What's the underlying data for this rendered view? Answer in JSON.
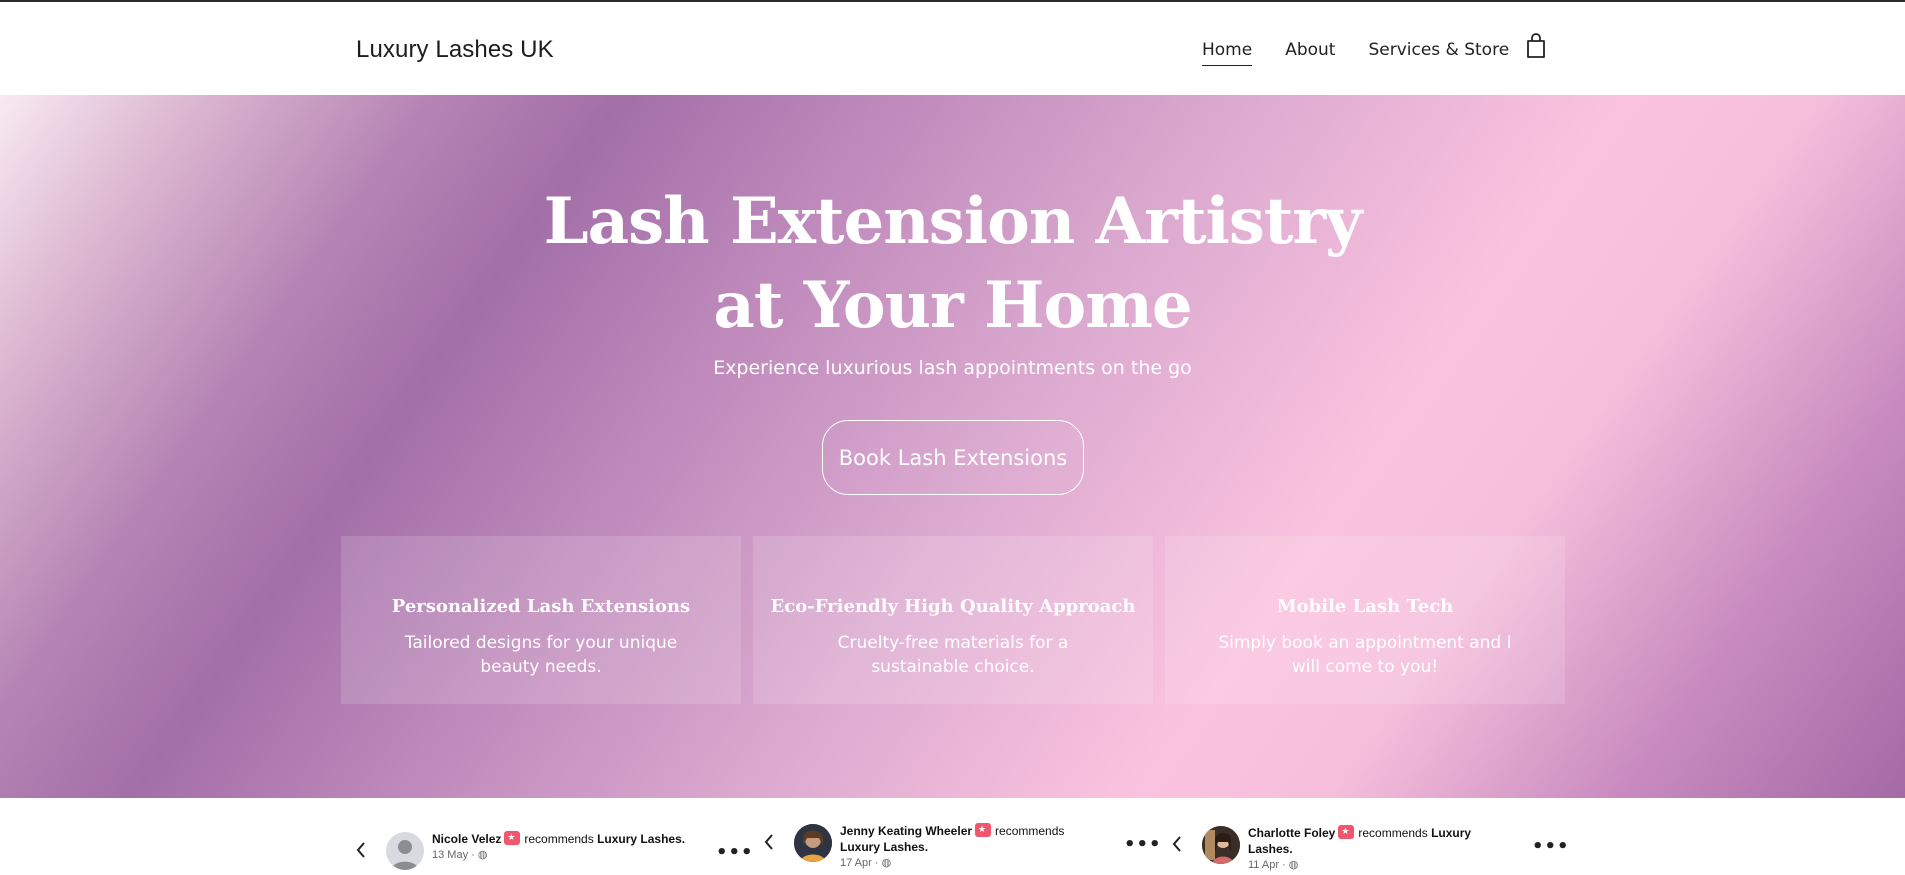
{
  "header": {
    "brand": "Luxury Lashes UK",
    "nav": [
      {
        "label": "Home",
        "active": true
      },
      {
        "label": "About"
      },
      {
        "label": "Services & Store"
      }
    ],
    "cart_icon": "shopping-bag-icon"
  },
  "hero": {
    "title_line1": "Lash Extension Artistry",
    "title_line2": "at Your Home",
    "subtitle": "Experience luxurious lash appointments on the go",
    "cta_label": "Book Lash Extensions",
    "gradient_colors": [
      "#f8eaf1",
      "#a36fa8",
      "#fbc3df",
      "#a46aa6"
    ]
  },
  "features": [
    {
      "title": "Personalized Lash Extensions",
      "text": "Tailored designs for your unique beauty needs."
    },
    {
      "title": "Eco-Friendly High Quality Approach",
      "text": "Cruelty-free materials for a sustainable choice."
    },
    {
      "title": "Mobile Lash Tech",
      "text": "Simply book an appointment and I will come to you!"
    }
  ],
  "reviews": [
    {
      "name": "Nicole Velez",
      "recommends": "recommends",
      "business": "Luxury Lashes.",
      "date": "13 May",
      "avatar": "default-person-avatar"
    },
    {
      "name": "Jenny Keating Wheeler",
      "recommends": "recommends",
      "business": "Luxury Lashes.",
      "date": "17 Apr",
      "avatar": "photo-avatar"
    },
    {
      "name": "Charlotte Foley",
      "recommends": "recommends",
      "business": "Luxury Lashes.",
      "date": "11 Apr",
      "avatar": "photo-avatar"
    }
  ],
  "review_meta_separator": " · ",
  "accent_badge_color": "#f0566e"
}
